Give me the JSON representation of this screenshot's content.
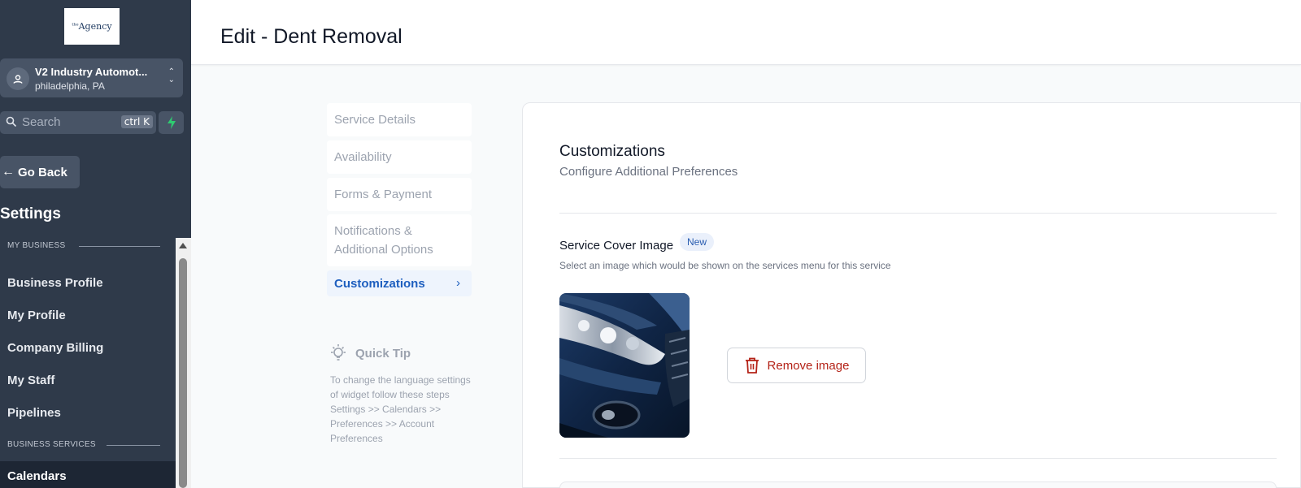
{
  "app": {
    "logo_text": "Agency",
    "logo_superscript": "the"
  },
  "location": {
    "name": "V2 Industry Automot...",
    "city": "philadelphia, PA"
  },
  "search": {
    "placeholder": "Search",
    "shortcut": "ctrl K"
  },
  "sidebar": {
    "go_back": "Go Back",
    "heading": "Settings",
    "sections": [
      {
        "label": "MY BUSINESS",
        "items": [
          "Business Profile",
          "My Profile",
          "Company Billing",
          "My Staff",
          "Pipelines"
        ]
      },
      {
        "label": "BUSINESS SERVICES",
        "items": [
          "Calendars"
        ]
      }
    ],
    "active_item": "Calendars"
  },
  "header": {
    "title": "Edit - Dent Removal"
  },
  "steps": [
    {
      "label": "Service Details",
      "active": false
    },
    {
      "label": "Availability",
      "active": false
    },
    {
      "label": "Forms & Payment",
      "active": false
    },
    {
      "label": "Notifications & Additional Options",
      "active": false
    },
    {
      "label": "Customizations",
      "active": true
    }
  ],
  "quick_tip": {
    "title": "Quick Tip",
    "body": "To change the language settings of widget follow these steps Settings >> Calendars >> Preferences >> Account Preferences"
  },
  "card": {
    "title": "Customizations",
    "subtitle": "Configure Additional Preferences",
    "cover_label": "Service Cover Image",
    "badge": "New",
    "cover_help": "Select an image which would be shown on the services menu for this service",
    "remove_label": "Remove image"
  },
  "colors": {
    "sidebar_bg": "#2f3a4a",
    "accent_blue": "#1e5fbf",
    "danger_red": "#b42318",
    "bolt_green": "#2ecc71"
  },
  "icons": {
    "location": "location-pin-icon",
    "search": "search-icon",
    "bolt": "lightning-bolt-icon",
    "back": "arrow-left-icon",
    "bulb": "light-bulb-icon",
    "trash": "trash-icon",
    "chevron": "chevron-right-icon"
  }
}
